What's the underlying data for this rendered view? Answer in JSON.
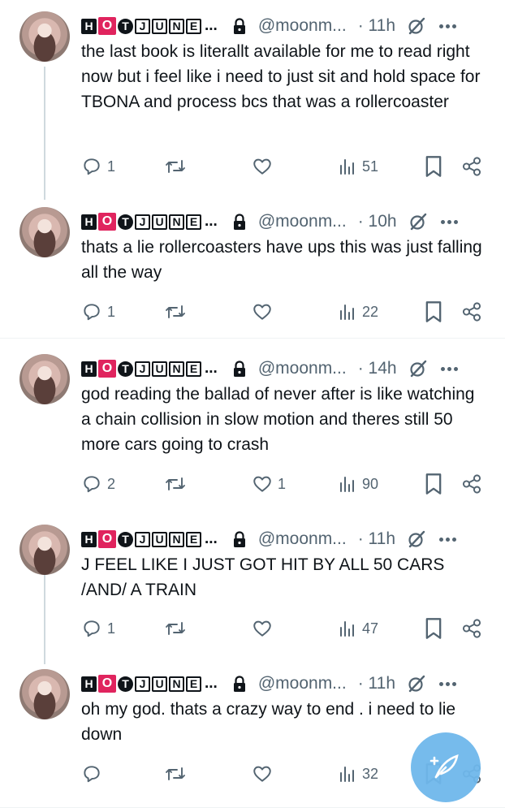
{
  "colors": {
    "text": "#0f1419",
    "muted": "#536471",
    "fab": "#6fb8ec",
    "badge_red": "#e0245e"
  },
  "author": {
    "name_letters": [
      "H",
      "O",
      "T",
      "J",
      "U",
      "N",
      "E"
    ],
    "name_ellipsis": "...",
    "handle": "@moonm...",
    "locked": true,
    "avatar_icon": "avatar-image"
  },
  "tweets": [
    {
      "time": "· 11h",
      "text": "the last book is literallt available for me to read right now but i feel like i need to just sit and hold space for TBONA and process bcs that was a rollercoaster",
      "replies": "1",
      "reposts": "",
      "likes": "",
      "views": "51"
    },
    {
      "time": "· 10h",
      "text": "thats a lie rollercoasters have ups this was just falling all the way",
      "replies": "1",
      "reposts": "",
      "likes": "",
      "views": "22"
    },
    {
      "time": "· 14h",
      "text": "god reading the ballad of never after is like watching a chain collision in slow motion and theres still 50 more cars going to crash",
      "replies": "2",
      "reposts": "",
      "likes": "1",
      "views": "90"
    },
    {
      "time": "· 11h",
      "text": "J FEEL LIKE I JUST GOT HIT BY ALL 50 CARS /AND/ A TRAIN",
      "replies": "1",
      "reposts": "",
      "likes": "",
      "views": "47"
    },
    {
      "time": "· 11h",
      "text": "oh my god. thats a crazy way to end . i need to lie down",
      "replies": "",
      "reposts": "",
      "likes": "",
      "views": "32"
    }
  ],
  "fab": {
    "icon": "compose-feather-icon"
  }
}
